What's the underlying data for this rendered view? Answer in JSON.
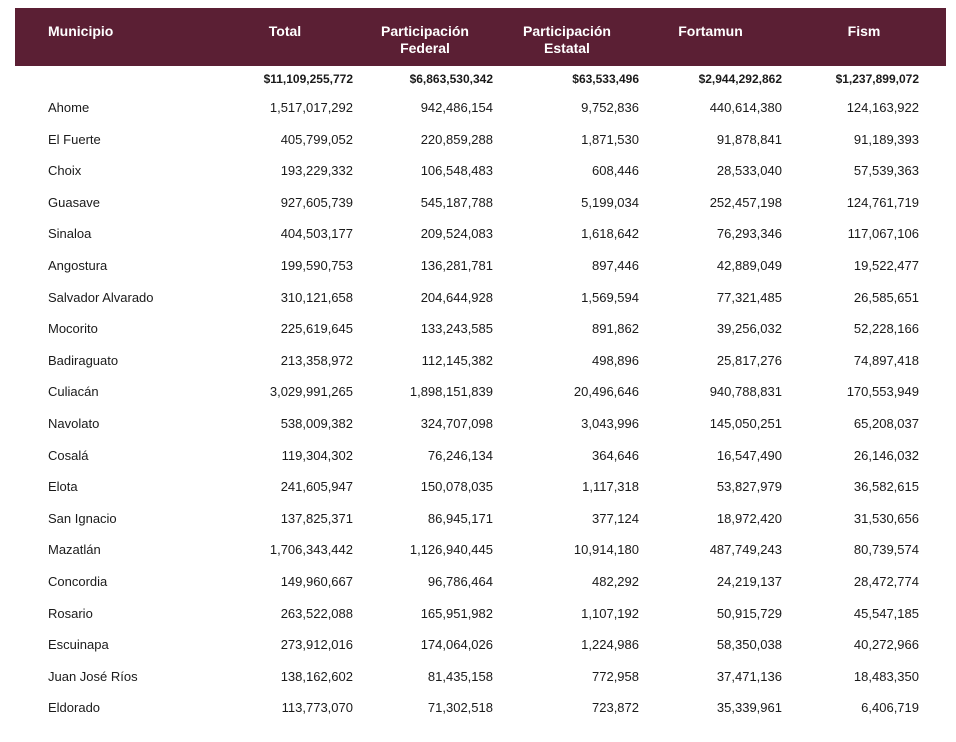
{
  "headers": {
    "municipio": "Municipio",
    "total": "Total",
    "participacion_federal": "Participación\nFederal",
    "participacion_estatal": "Participación\nEstatal",
    "fortamun": "Fortamun",
    "fism": "Fism"
  },
  "totals": {
    "total": "$11,109,255,772",
    "participacion_federal": "$6,863,530,342",
    "participacion_estatal": "$63,533,496",
    "fortamun": "$2,944,292,862",
    "fism": "$1,237,899,072"
  },
  "rows": [
    {
      "municipio": "Ahome",
      "total": "1,517,017,292",
      "federal": "942,486,154",
      "estatal": "9,752,836",
      "fortamun": "440,614,380",
      "fism": "124,163,922"
    },
    {
      "municipio": "El Fuerte",
      "total": "405,799,052",
      "federal": "220,859,288",
      "estatal": "1,871,530",
      "fortamun": "91,878,841",
      "fism": "91,189,393"
    },
    {
      "municipio": "Choix",
      "total": "193,229,332",
      "federal": "106,548,483",
      "estatal": "608,446",
      "fortamun": "28,533,040",
      "fism": "57,539,363"
    },
    {
      "municipio": "Guasave",
      "total": "927,605,739",
      "federal": "545,187,788",
      "estatal": "5,199,034",
      "fortamun": "252,457,198",
      "fism": "124,761,719"
    },
    {
      "municipio": "Sinaloa",
      "total": "404,503,177",
      "federal": "209,524,083",
      "estatal": "1,618,642",
      "fortamun": "76,293,346",
      "fism": "117,067,106"
    },
    {
      "municipio": "Angostura",
      "total": "199,590,753",
      "federal": "136,281,781",
      "estatal": "897,446",
      "fortamun": "42,889,049",
      "fism": "19,522,477"
    },
    {
      "municipio": "Salvador Alvarado",
      "total": "310,121,658",
      "federal": "204,644,928",
      "estatal": "1,569,594",
      "fortamun": "77,321,485",
      "fism": "26,585,651"
    },
    {
      "municipio": "Mocorito",
      "total": "225,619,645",
      "federal": "133,243,585",
      "estatal": "891,862",
      "fortamun": "39,256,032",
      "fism": "52,228,166"
    },
    {
      "municipio": "Badiraguato",
      "total": "213,358,972",
      "federal": "112,145,382",
      "estatal": "498,896",
      "fortamun": "25,817,276",
      "fism": "74,897,418"
    },
    {
      "municipio": "Culiacán",
      "total": "3,029,991,265",
      "federal": "1,898,151,839",
      "estatal": "20,496,646",
      "fortamun": "940,788,831",
      "fism": "170,553,949"
    },
    {
      "municipio": "Navolato",
      "total": "538,009,382",
      "federal": "324,707,098",
      "estatal": "3,043,996",
      "fortamun": "145,050,251",
      "fism": "65,208,037"
    },
    {
      "municipio": "Cosalá",
      "total": "119,304,302",
      "federal": "76,246,134",
      "estatal": "364,646",
      "fortamun": "16,547,490",
      "fism": "26,146,032"
    },
    {
      "municipio": "Elota",
      "total": "241,605,947",
      "federal": "150,078,035",
      "estatal": "1,117,318",
      "fortamun": "53,827,979",
      "fism": "36,582,615"
    },
    {
      "municipio": "San Ignacio",
      "total": "137,825,371",
      "federal": "86,945,171",
      "estatal": "377,124",
      "fortamun": "18,972,420",
      "fism": "31,530,656"
    },
    {
      "municipio": "Mazatlán",
      "total": "1,706,343,442",
      "federal": "1,126,940,445",
      "estatal": "10,914,180",
      "fortamun": "487,749,243",
      "fism": "80,739,574"
    },
    {
      "municipio": "Concordia",
      "total": "149,960,667",
      "federal": "96,786,464",
      "estatal": "482,292",
      "fortamun": "24,219,137",
      "fism": "28,472,774"
    },
    {
      "municipio": "Rosario",
      "total": "263,522,088",
      "federal": "165,951,982",
      "estatal": "1,107,192",
      "fortamun": "50,915,729",
      "fism": "45,547,185"
    },
    {
      "municipio": "Escuinapa",
      "total": "273,912,016",
      "federal": "174,064,026",
      "estatal": "1,224,986",
      "fortamun": "58,350,038",
      "fism": "40,272,966"
    },
    {
      "municipio": "Juan José Ríos",
      "total": "138,162,602",
      "federal": "81,435,158",
      "estatal": "772,958",
      "fortamun": "37,471,136",
      "fism": "18,483,350"
    },
    {
      "municipio": "Eldorado",
      "total": "113,773,070",
      "federal": "71,302,518",
      "estatal": "723,872",
      "fortamun": "35,339,961",
      "fism": "6,406,719"
    }
  ],
  "colors": {
    "header_background": "#5b1f34",
    "header_text": "#ffffff",
    "body_text": "#1a1a1a"
  }
}
